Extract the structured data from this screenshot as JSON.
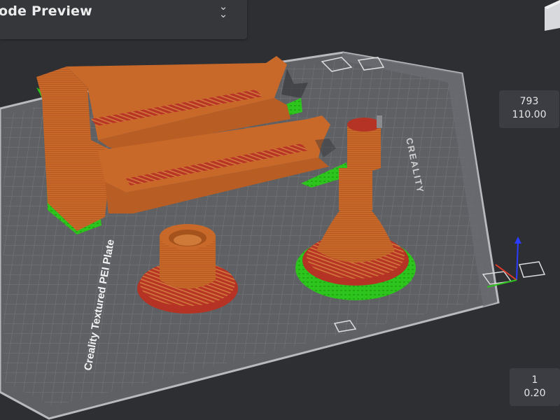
{
  "panel": {
    "title": "ode Preview",
    "collapse_icon": "double-chevron-down-icon"
  },
  "plate": {
    "label": "Creality Textured PEI Plate",
    "brand": "CREALITY"
  },
  "layer_slider": {
    "max_layer": "793",
    "max_height": "110.00",
    "min_layer": "1",
    "min_height": "0.20"
  },
  "colors": {
    "background": "#2e2f33",
    "plate": "#5f6064",
    "grid": "#8a8b8f",
    "model": "#c8692a",
    "top_surface": "#c0392b",
    "support": "#2ec41e"
  }
}
